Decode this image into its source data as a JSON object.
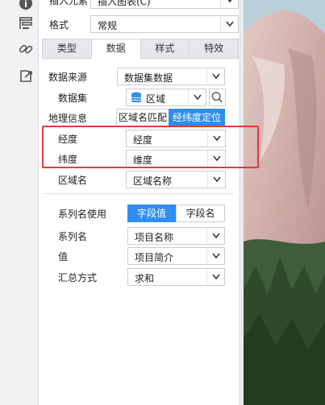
{
  "toolbar": {
    "insert_label": "插入元素",
    "insert_value": "插入图表(C)",
    "format_label": "格式",
    "format_value": "常规"
  },
  "tabs": [
    {
      "label": "类型",
      "active": false
    },
    {
      "label": "数据",
      "active": true
    },
    {
      "label": "样式",
      "active": false
    },
    {
      "label": "特效",
      "active": false
    }
  ],
  "form": {
    "data_source_label": "数据来源",
    "data_source_value": "数据集数据",
    "dataset_label": "数据集",
    "dataset_value": "区域",
    "geo_label": "地理信息",
    "geo_options": [
      "区域名匹配",
      "经纬度定位"
    ],
    "geo_selected": "经纬度定位",
    "longitude_label": "经度",
    "longitude_value": "经度",
    "latitude_label": "纬度",
    "latitude_value": "维度",
    "region_label": "区域名",
    "region_value": "区域名称",
    "series_use_label": "系列名使用",
    "series_use_options": [
      "字段值",
      "字段名"
    ],
    "series_use_selected": "字段值",
    "series_label": "系列名",
    "series_value": "项目名称",
    "value_label": "值",
    "value_value": "项目简介",
    "agg_label": "汇总方式",
    "agg_value": "求和"
  },
  "icons": [
    "info-icon",
    "layout-icon",
    "link-icon",
    "export-icon",
    "database-icon",
    "search-icon",
    "chevron-down-icon"
  ],
  "colors": {
    "accent": "#2f8ef0",
    "highlight": "#e23a3a"
  }
}
